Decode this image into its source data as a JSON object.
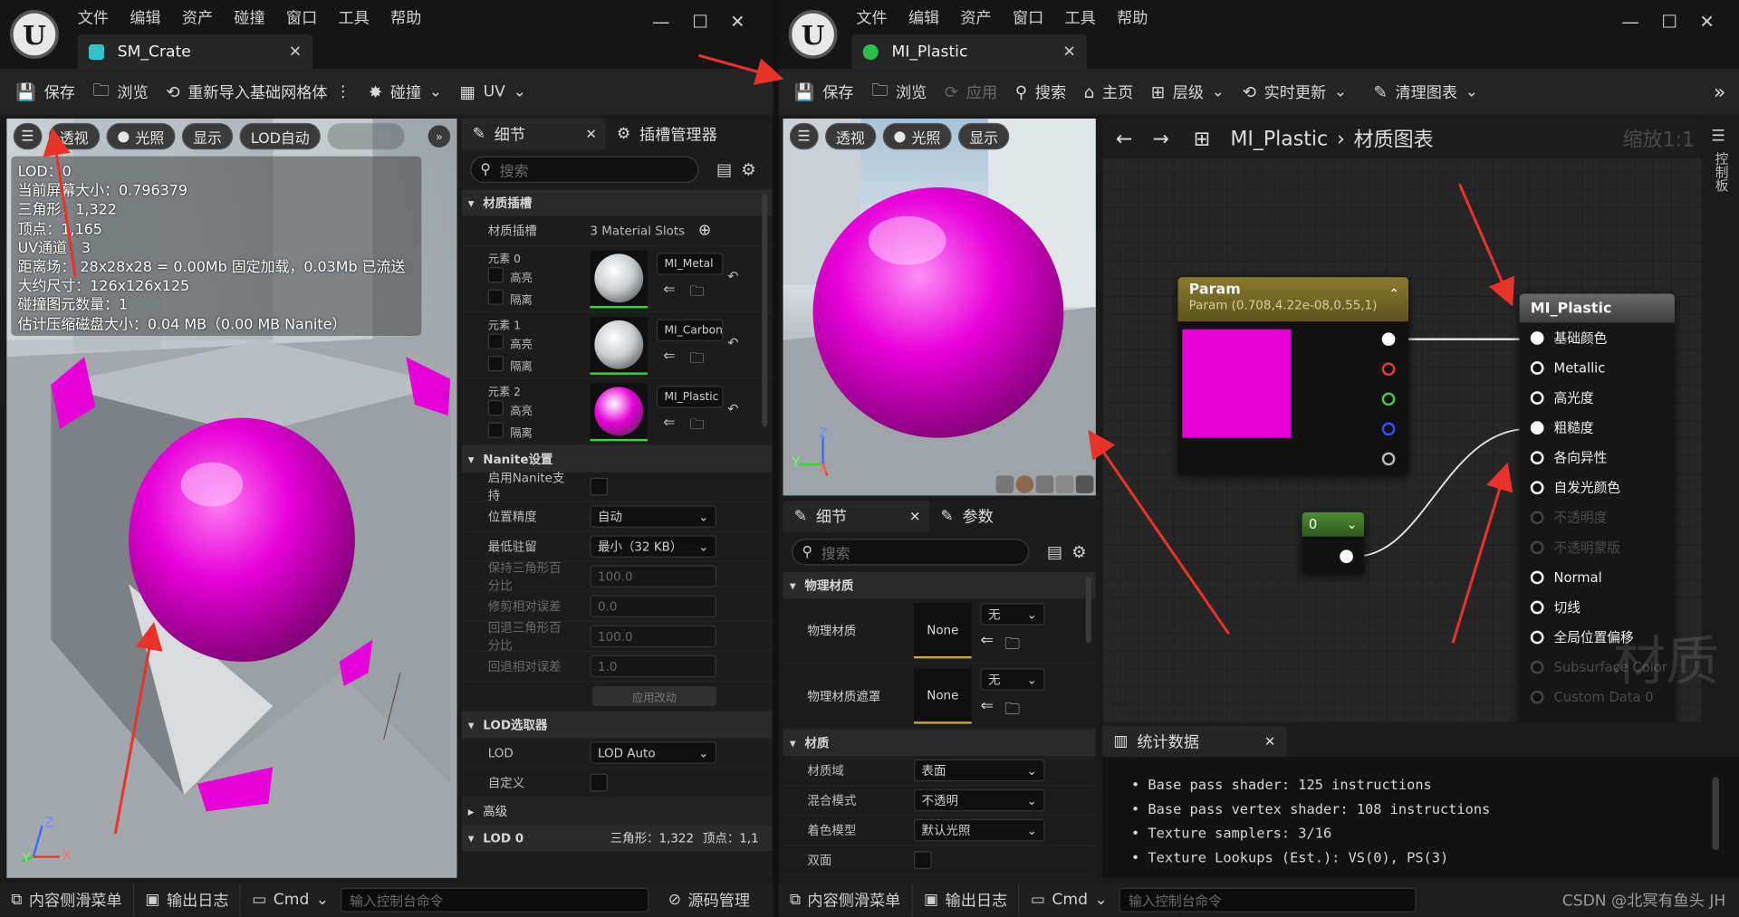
{
  "left": {
    "menu": [
      "文件",
      "编辑",
      "资产",
      "碰撞",
      "窗口",
      "工具",
      "帮助"
    ],
    "tab_title": "SM_Crate",
    "toolbar": {
      "save": "保存",
      "browse": "浏览",
      "reimport": "重新导入基础网格体",
      "collision": "碰撞",
      "uv": "UV"
    },
    "viewport_buttons": {
      "perspective": "透视",
      "lit": "光照",
      "show": "显示",
      "lod_auto": "LOD自动"
    },
    "stats": [
      "LOD：0",
      "当前屏幕大小：0.796379",
      "三角形：1,322",
      "顶点：1,165",
      "UV通道：3",
      "距离场：  28x28x28 = 0.00Mb 固定加载，0.03Mb 已流送",
      "大约尺寸：126x126x125",
      "碰撞图元数量：1",
      "估计压缩磁盘大小：0.04 MB（0.00 MB Nanite）"
    ],
    "axis": {
      "z": "Z",
      "y": "Y",
      "x": "X"
    },
    "details": {
      "tab_details": "细节",
      "tab_sockets": "插槽管理器",
      "search_placeholder": "搜索",
      "sec_material_slots": "材质插槽",
      "slots_label": "材质插槽",
      "slots_value": "3 Material Slots",
      "elements": [
        {
          "name": "元素 0",
          "highlight": "高亮",
          "isolate": "隔离",
          "material": "MI_Metal"
        },
        {
          "name": "元素 1",
          "highlight": "高亮",
          "isolate": "隔离",
          "material": "MI_Carbon"
        },
        {
          "name": "元素 2",
          "highlight": "高亮",
          "isolate": "隔离",
          "material": "MI_Plastic"
        }
      ],
      "sec_nanite": "Nanite设置",
      "nanite_rows": [
        {
          "label": "启用Nanite支持",
          "value": ""
        },
        {
          "label": "位置精度",
          "value": "自动"
        },
        {
          "label": "最低驻留",
          "value": "最小（32 KB）"
        },
        {
          "label": "保持三角形百分比",
          "value": "100.0"
        },
        {
          "label": "修剪相对误差",
          "value": "0.0"
        },
        {
          "label": "回退三角形百分比",
          "value": "100.0"
        },
        {
          "label": "回退相对误差",
          "value": "1.0"
        }
      ],
      "apply": "应用改动",
      "sec_lod_picker": "LOD选取器",
      "lod_label": "LOD",
      "lod_value": "LOD Auto",
      "custom_label": "自定义",
      "sec_advanced": "高级",
      "sec_lod0": "LOD 0",
      "lod0_tri": "三角形：1,322",
      "lod0_vert": "顶点：1,1"
    },
    "bottom": {
      "drawer": "内容侧滑菜单",
      "log": "输出日志",
      "cmd": "Cmd",
      "cmd_placeholder": "输入控制台命令",
      "source": "源码管理"
    }
  },
  "right": {
    "menu": [
      "文件",
      "编辑",
      "资产",
      "窗口",
      "工具",
      "帮助"
    ],
    "tab_title": "MI_Plastic",
    "toolbar": {
      "save": "保存",
      "browse": "浏览",
      "apply": "应用",
      "search": "搜索",
      "home": "主页",
      "hierarchy": "层级",
      "live_update": "实时更新",
      "clean_graph": "清理图表"
    },
    "viewport_buttons": {
      "perspective": "透视",
      "lit": "光照",
      "show": "显示"
    },
    "axis": {
      "z": "Z",
      "y": "Y",
      "x": "X"
    },
    "details": {
      "tab_details": "细节",
      "tab_params": "参数",
      "search_placeholder": "搜索",
      "sec_phys": "物理材质",
      "phys_label": "物理材质",
      "phys_value": "None",
      "phys_dd": "无",
      "phys_mask_label": "物理材质遮罩",
      "phys_mask_value": "None",
      "phys_mask_dd": "无",
      "sec_material": "材质",
      "mat_rows": [
        {
          "label": "材质域",
          "value": "表面"
        },
        {
          "label": "混合模式",
          "value": "不透明"
        },
        {
          "label": "着色模型",
          "value": "默认光照"
        },
        {
          "label": "双面",
          "value": ""
        }
      ]
    },
    "graph": {
      "breadcrumb_asset": "MI_Plastic",
      "breadcrumb_graph": "材质图表",
      "zoom": "缩放1:1",
      "side_tab": "控制板",
      "param_node": {
        "title": "Param",
        "subtitle": "Param (0.708,4.22e-08,0.55,1)",
        "color": "#e600d8"
      },
      "scalar_node": {
        "value": "0"
      },
      "output_node": {
        "title": "MI_Plastic",
        "pins": [
          {
            "label": "基础颜色",
            "active": true
          },
          {
            "label": "Metallic",
            "active": true
          },
          {
            "label": "高光度",
            "active": true
          },
          {
            "label": "粗糙度",
            "active": true
          },
          {
            "label": "各向异性",
            "active": true
          },
          {
            "label": "自发光颜色",
            "active": true
          },
          {
            "label": "不透明度",
            "active": false
          },
          {
            "label": "不透明蒙版",
            "active": false
          },
          {
            "label": "Normal",
            "active": true
          },
          {
            "label": "切线",
            "active": true
          },
          {
            "label": "全局位置偏移",
            "active": true
          },
          {
            "label": "Subsurface Color",
            "active": false
          },
          {
            "label": "Custom Data 0",
            "active": false
          }
        ]
      },
      "watermark": "材质"
    },
    "stats": {
      "title": "统计数据",
      "lines": [
        "Base pass shader: 125 instructions",
        "Base pass vertex shader: 108 instructions",
        "Texture samplers: 3/16",
        "Texture Lookups (Est.): VS(0), PS(3)"
      ]
    },
    "bottom": {
      "drawer": "内容侧滑菜单",
      "log": "输出日志",
      "cmd": "Cmd",
      "cmd_placeholder": "输入控制台命令"
    },
    "credit": "CSDN @北冥有鱼头 JH"
  },
  "colors": {
    "accent_magenta": "#e600d8",
    "annotation_red": "#e8322a",
    "node_param_header": "#8a7a2e",
    "node_scalar_header": "#3f6f2a"
  }
}
